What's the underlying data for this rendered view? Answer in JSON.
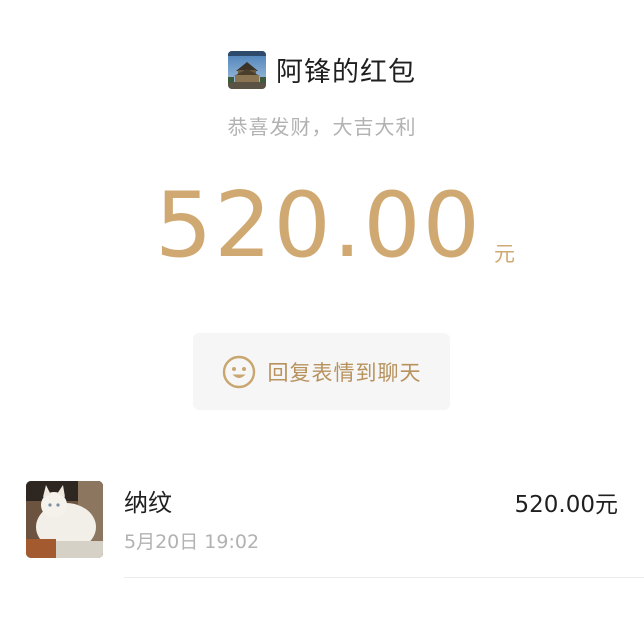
{
  "sender": {
    "avatar_icon": "temple-photo-avatar",
    "title": "阿锋的红包",
    "greeting": "恭喜发财，大吉大利"
  },
  "amount": {
    "value": "520.00",
    "unit": "元",
    "color": "#cfa971"
  },
  "reply_button": {
    "icon": "smile-icon",
    "label": "回复表情到聊天",
    "label_color": "#b8925d"
  },
  "receivers": [
    {
      "avatar_icon": "white-cat-photo-avatar",
      "name": "纳纹",
      "time": "5月20日  19:02",
      "amount": "520.00元"
    }
  ]
}
